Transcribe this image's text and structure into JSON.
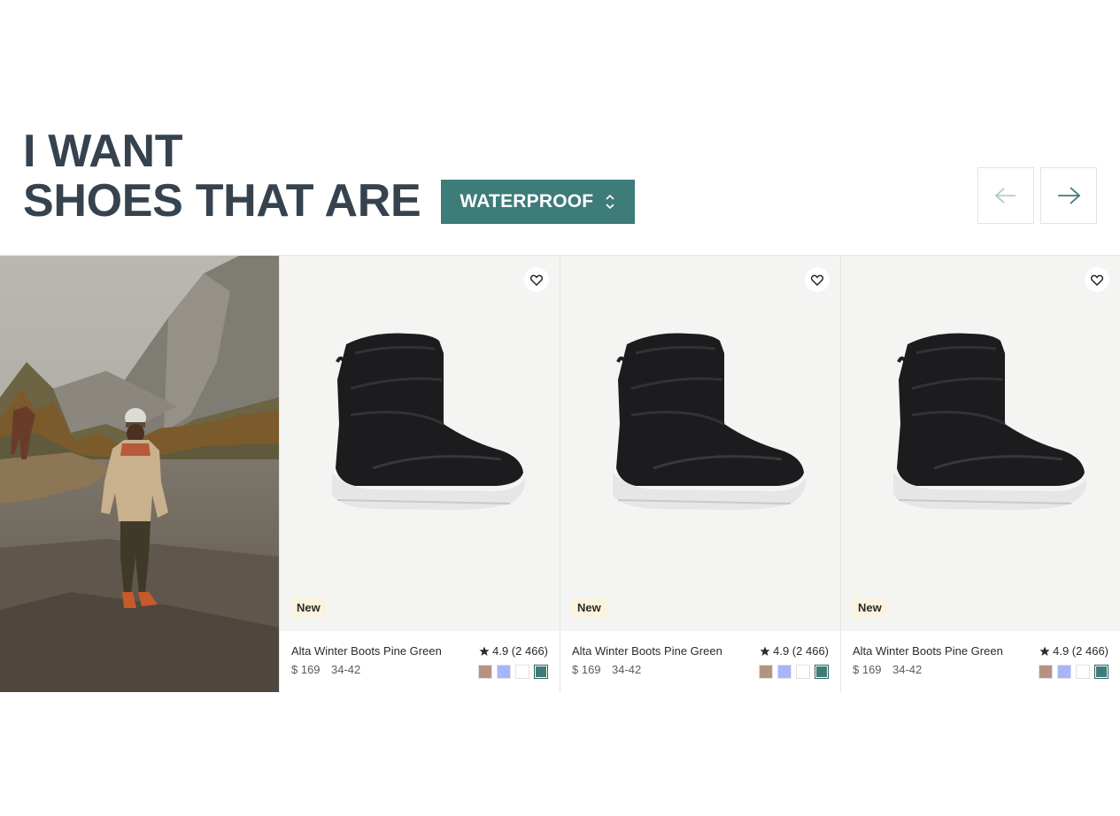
{
  "headline": {
    "line1": "I WANT",
    "line2": "SHOES THAT ARE",
    "filter_value": "WATERPROOF"
  },
  "nav": {
    "prev_icon": "arrow-left-icon",
    "next_icon": "arrow-right-icon"
  },
  "colors": {
    "accent": "#3d7c78",
    "heading": "#36434e",
    "badge_bg": "#fbf3de"
  },
  "products": [
    {
      "name": "Alta Winter Boots Pine Green",
      "rating": "4.9 (2 466)",
      "price": "$ 169",
      "sizes": "34-42",
      "badge": "New",
      "swatches": [
        "#b39481",
        "#a8b4fb",
        "#ffffff",
        "#3d7c78"
      ]
    },
    {
      "name": "Alta Winter Boots Pine Green",
      "rating": "4.9 (2 466)",
      "price": "$ 169",
      "sizes": "34-42",
      "badge": "New",
      "swatches": [
        "#b39481",
        "#a8b4fb",
        "#ffffff",
        "#3d7c78"
      ]
    },
    {
      "name": "Alta Winter Boots Pine Green",
      "rating": "4.9 (2 466)",
      "price": "$ 169",
      "sizes": "34-42",
      "badge": "New",
      "swatches": [
        "#b39481",
        "#a8b4fb",
        "#ffffff",
        "#3d7c78"
      ]
    }
  ]
}
